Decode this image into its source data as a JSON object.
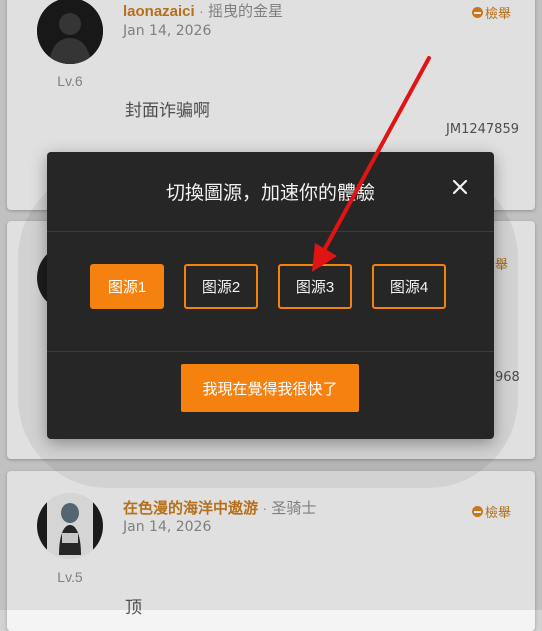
{
  "posts": [
    {
      "username": "laonazaici",
      "separator": "·",
      "title": "摇曳的金星",
      "date": "Jan 14, 2026",
      "level": "Lv.6",
      "report_label": "檢舉",
      "body": "封面诈骗啊",
      "post_id": "JM1247859"
    },
    {
      "partial_report": "舉",
      "partial_id": "968"
    },
    {
      "username": "在色漫的海洋中遨游",
      "separator": "·",
      "title": "圣骑士",
      "date": "Jan 14, 2026",
      "level": "Lv.5",
      "report_label": "檢舉",
      "body": "顶"
    }
  ],
  "modal": {
    "title": "切換圖源，加速你的體驗",
    "sources": [
      "图源1",
      "图源2",
      "图源3",
      "图源4"
    ],
    "active_source": "图源1",
    "confirm_label": "我現在覺得我很快了"
  },
  "colors": {
    "accent": "#f5820f",
    "modal_bg": "#262626",
    "username": "#c47a1e",
    "annotation_arrow": "#e01414"
  },
  "icons": {
    "close": "close-icon",
    "report": "minus-circle-icon",
    "annotation": "red-arrow"
  }
}
